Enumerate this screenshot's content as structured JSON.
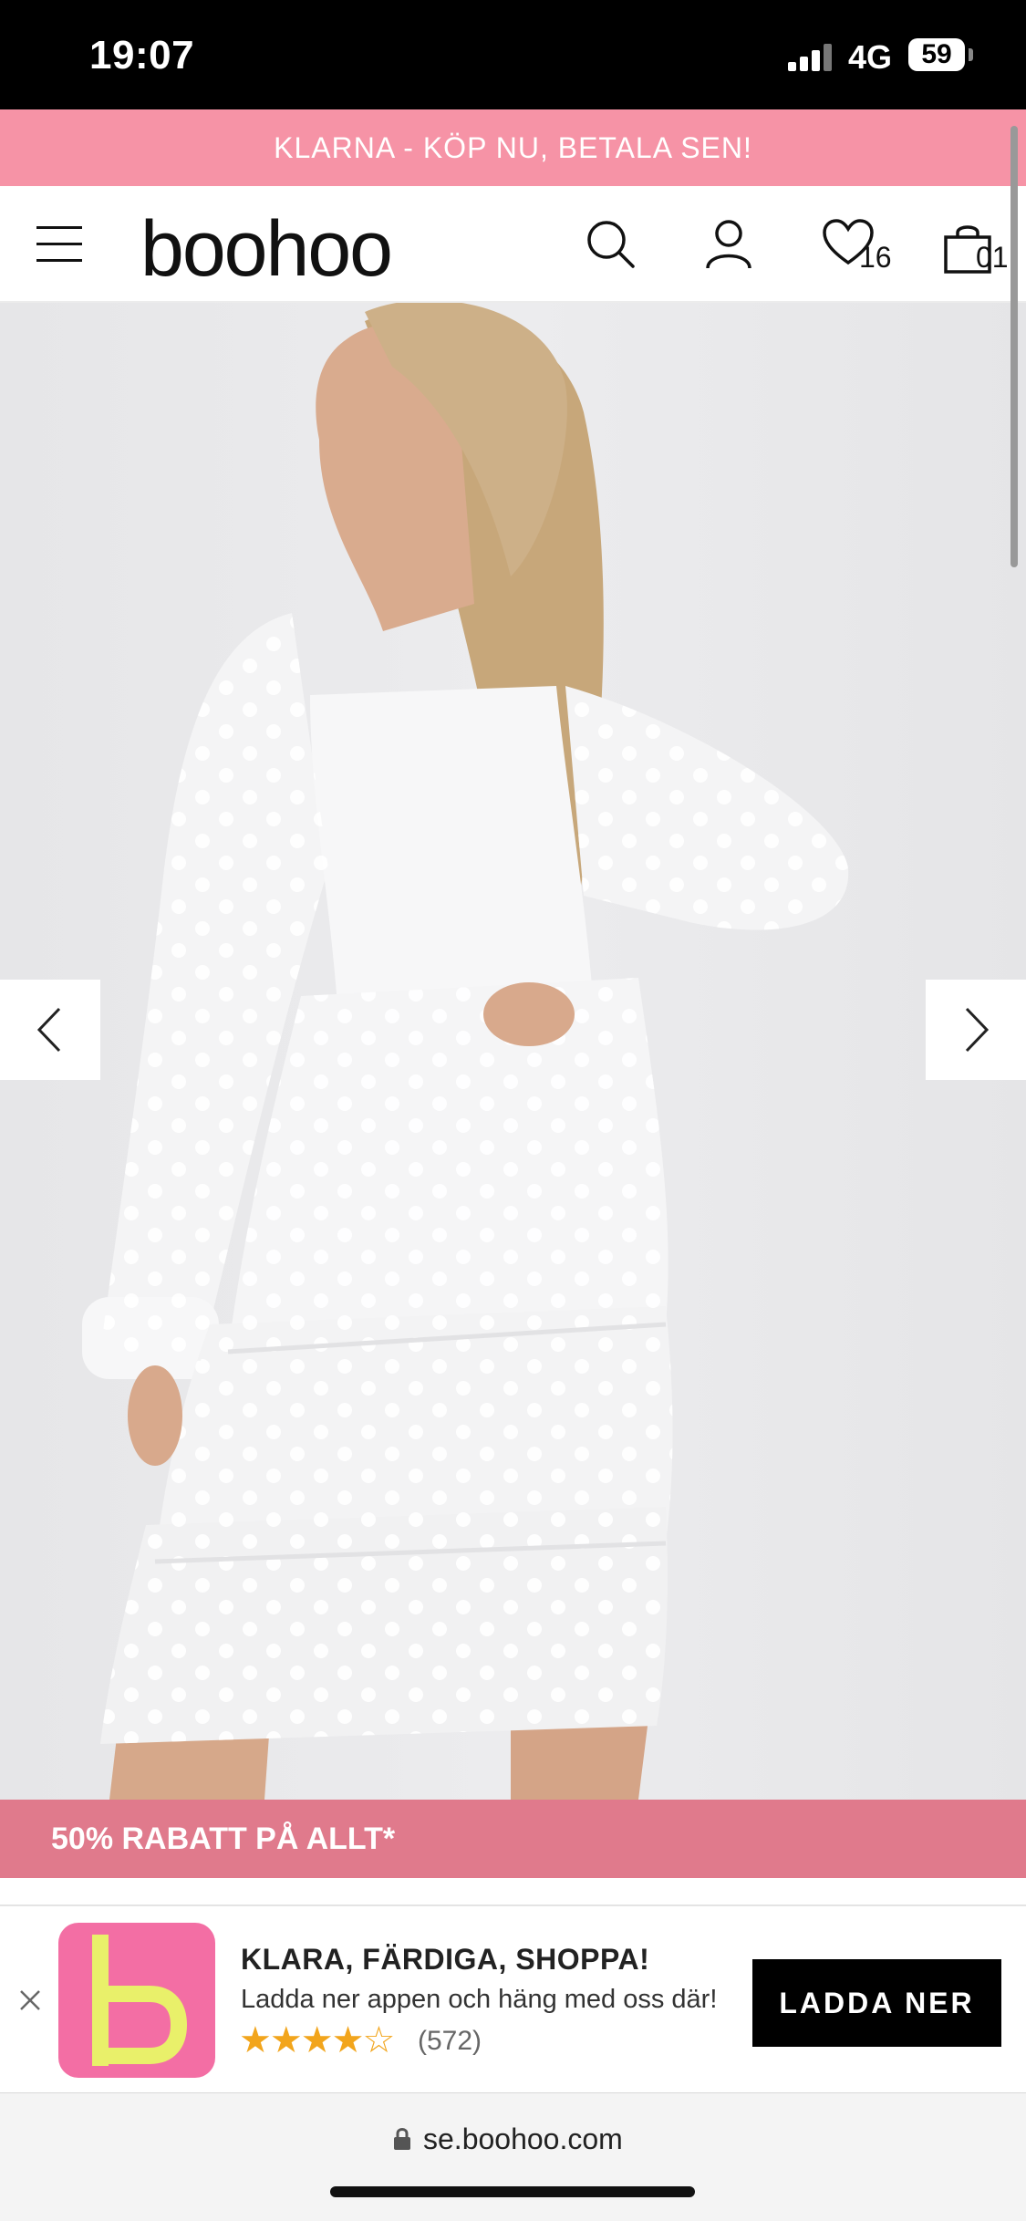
{
  "status_bar": {
    "time": "19:07",
    "network": "4G",
    "battery": "59"
  },
  "promo": {
    "text": "KLARNA - KÖP NU, BETALA SEN!"
  },
  "header": {
    "logo": "boohoo",
    "wishlist_count": "16",
    "bag_count": "01"
  },
  "product": {
    "image_alt": "woman in white plus-size dobby dress"
  },
  "sale_banner": {
    "text": "50% RABATT PÅ ALLT*"
  },
  "app_banner": {
    "title": "KLARA, FÄRDIGA, SHOPPA!",
    "subtitle": "Ladda ner appen och häng med oss där!",
    "stars": "★★★★☆",
    "rating": 4,
    "review_count": "(572)",
    "download_label": "LADDA NER"
  },
  "browser": {
    "url": "se.boohoo.com"
  },
  "colors": {
    "promo": "#f693a6",
    "sale": "#e07a8c",
    "app_logo": "#f36ea4",
    "logo_b": "#e9f06a",
    "star": "#f2a51c"
  },
  "icons": [
    "menu-icon",
    "search-icon",
    "account-icon",
    "heart-icon",
    "bag-icon",
    "chevron-left-icon",
    "chevron-right-icon",
    "close-icon",
    "lock-icon"
  ]
}
